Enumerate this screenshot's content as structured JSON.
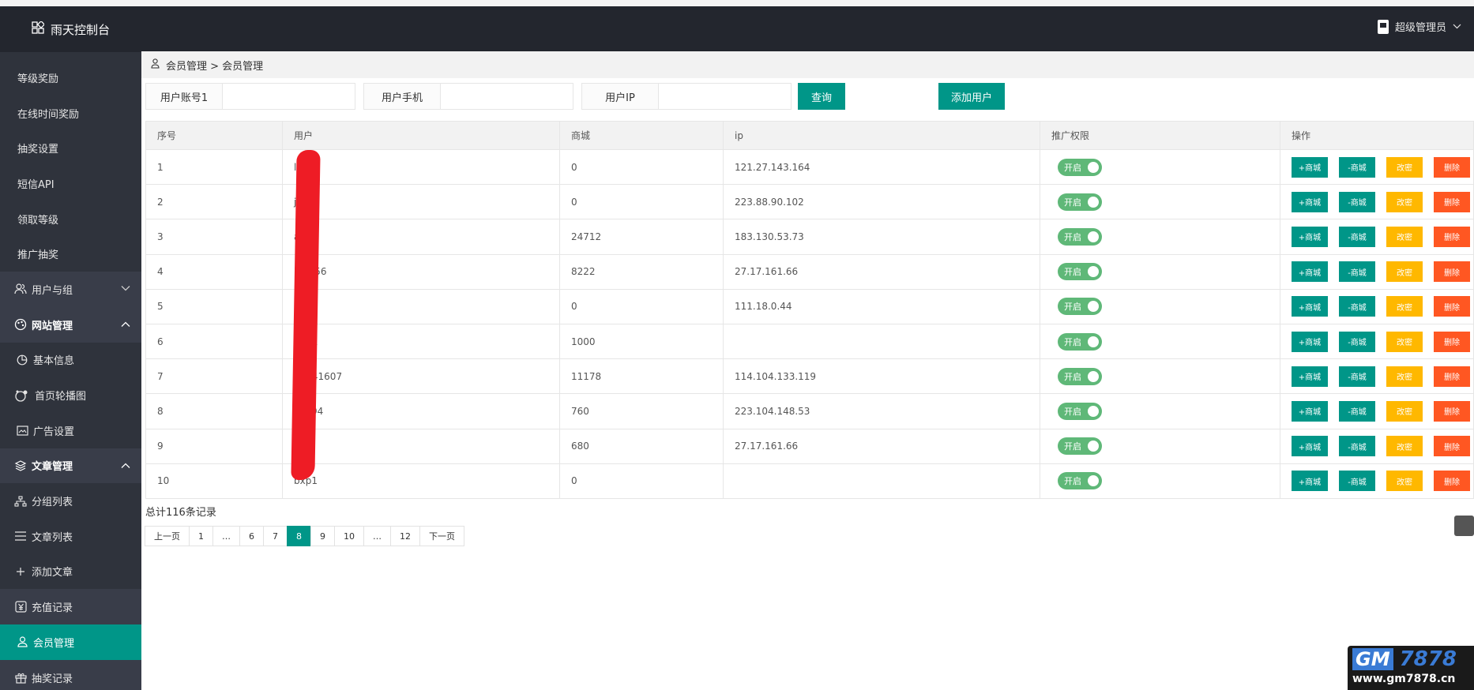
{
  "bookmarks": [
    "",
    "",
    "",
    "",
    "",
    "",
    "",
    "",
    "",
    ""
  ],
  "brand": {
    "title": "雨天控制台"
  },
  "header": {
    "user": "超级管理员"
  },
  "sidebar": {
    "items": [
      {
        "label": "等级奖励"
      },
      {
        "label": "在线时间奖励"
      },
      {
        "label": "抽奖设置"
      },
      {
        "label": "短信API"
      },
      {
        "label": "领取等级"
      },
      {
        "label": "推广抽奖"
      },
      {
        "label": "用户与组"
      },
      {
        "label": "网站管理"
      },
      {
        "label": "基本信息"
      },
      {
        "label": "首页轮播图"
      },
      {
        "label": "广告设置"
      },
      {
        "label": "文章管理"
      },
      {
        "label": "分组列表"
      },
      {
        "label": "文章列表"
      },
      {
        "label": "添加文章"
      },
      {
        "label": "充值记录"
      },
      {
        "label": "会员管理"
      },
      {
        "label": "抽奖记录"
      }
    ]
  },
  "breadcrumb": {
    "text": "会员管理 > 会员管理"
  },
  "filters": {
    "account_label": "用户账号1",
    "phone_label": "用户手机",
    "ip_label": "用户IP",
    "account_value": "",
    "phone_value": "",
    "ip_value": "",
    "query_button": "查询",
    "add_button": "添加用户"
  },
  "table": {
    "headers": [
      "序号",
      "用户",
      "商城",
      "ip",
      "推广权限",
      "操作"
    ],
    "toggle_label": "开启",
    "actions": [
      "+商城",
      "-商城",
      "改密",
      "删除"
    ],
    "rows": [
      {
        "no": "1",
        "user": "li4",
        "mall": "0",
        "ip": "121.27.143.164"
      },
      {
        "no": "2",
        "user": "jg55",
        "mall": "0",
        "ip": "223.88.90.102"
      },
      {
        "no": "3",
        "user": "a461",
        "mall": "24712",
        "ip": "183.130.53.73"
      },
      {
        "no": "4",
        "user": "l23456",
        "mall": "8222",
        "ip": "27.17.161.66"
      },
      {
        "no": "5",
        "user": "56",
        "mall": "0",
        "ip": "111.18.0.44"
      },
      {
        "no": "6",
        "user": "h001",
        "mall": "1000",
        "ip": ""
      },
      {
        "no": "7",
        "user": "14541607",
        "mall": "11178",
        "ip": "114.104.133.119"
      },
      {
        "no": "8",
        "user": "jj1994",
        "mall": "760",
        "ip": "223.104.148.53"
      },
      {
        "no": "9",
        "user": "22",
        "mall": "680",
        "ip": "27.17.161.66"
      },
      {
        "no": "10",
        "user": "bxp1",
        "mall": "0",
        "ip": ""
      }
    ]
  },
  "summary": {
    "total": "总计116条记录"
  },
  "pagination": {
    "prev": "上一页",
    "pages": [
      "1",
      "…",
      "6",
      "7",
      "8",
      "9",
      "10",
      "…",
      "12"
    ],
    "current": "8",
    "next": "下一页"
  },
  "watermark": {
    "gm": "GM",
    "num": "7878",
    "url": "www.gm7878.cn"
  },
  "colors": {
    "accent": "#009688",
    "warning": "#ffb800",
    "danger": "#ff5722",
    "sidebar": "#393d49",
    "header": "#23262e",
    "toggle": "#5fb878"
  }
}
